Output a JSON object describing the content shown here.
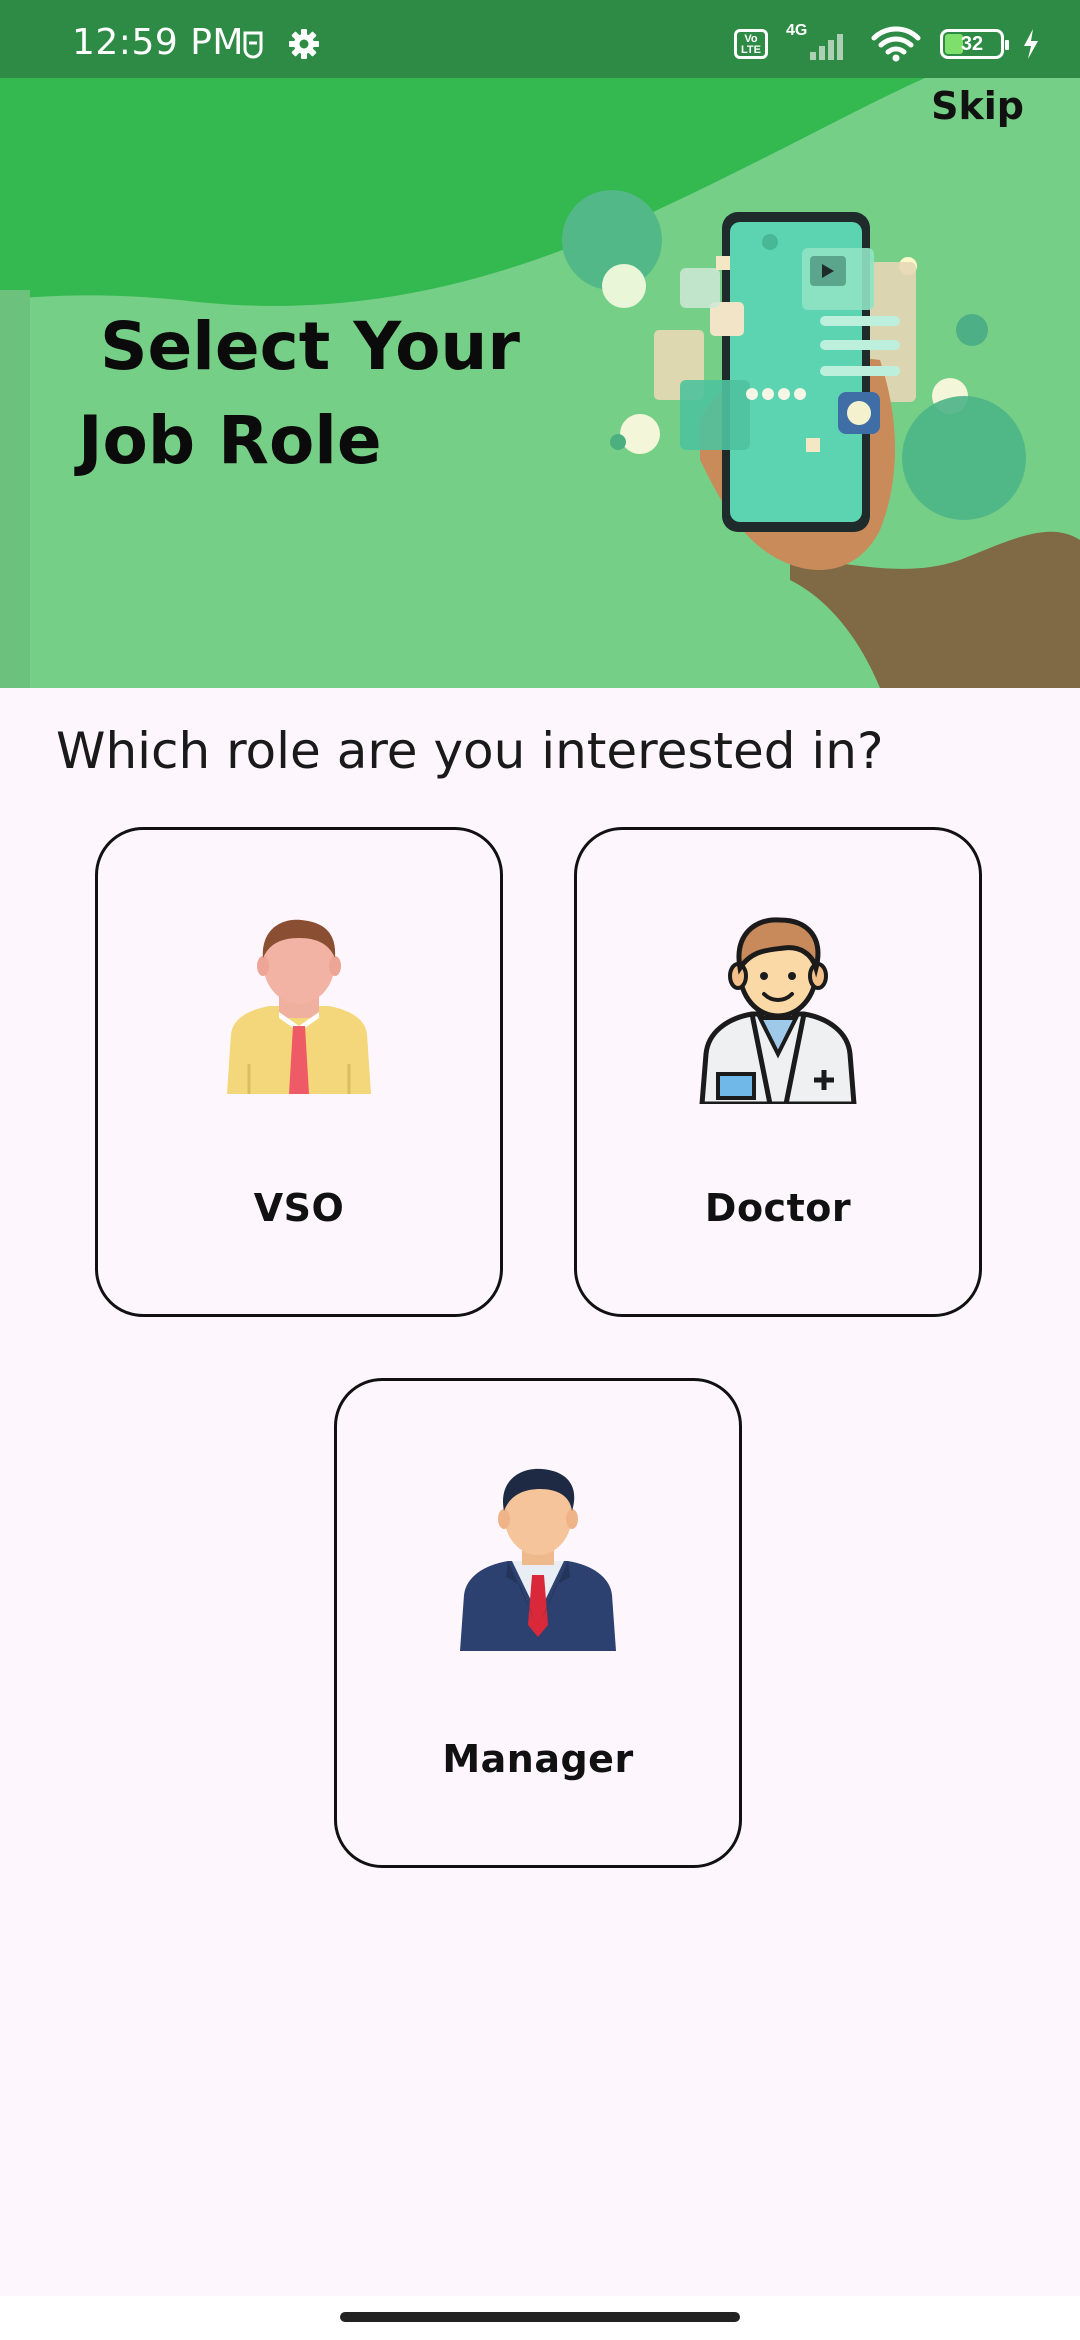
{
  "status_bar": {
    "time": "12:59 PM",
    "network": "4G",
    "volte_label": "Vo LTE",
    "battery_level": "32"
  },
  "header": {
    "skip_label": "Skip",
    "title_line1": "Select Your",
    "title_line2": "Job Role",
    "colors": {
      "banner": "#76cf86",
      "wave": "#34b850",
      "status_bar": "#2e8b45"
    }
  },
  "question": "Which role are you interested in?",
  "roles": [
    {
      "label": "VSO",
      "icon": "vso-person-icon"
    },
    {
      "label": "Doctor",
      "icon": "doctor-icon"
    },
    {
      "label": "Manager",
      "icon": "manager-icon"
    }
  ]
}
